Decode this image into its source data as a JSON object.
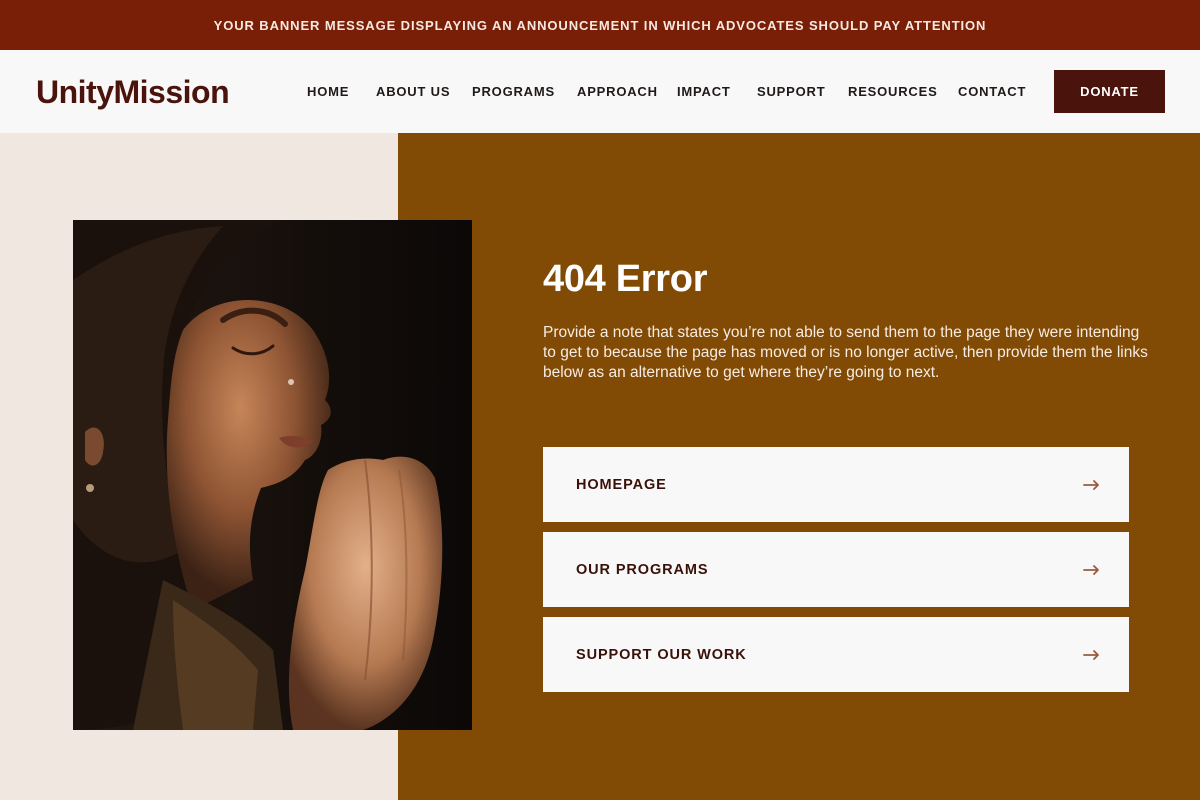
{
  "banner": {
    "text": "YOUR BANNER MESSAGE DISPLAYING AN ANNOUNCEMENT IN WHICH ADVOCATES SHOULD PAY ATTENTION"
  },
  "header": {
    "logo": "UnityMission",
    "nav": [
      "HOME",
      "ABOUT US",
      "PROGRAMS",
      "APPROACH",
      "IMPACT",
      "SUPPORT",
      "RESOURCES",
      "CONTACT"
    ],
    "donate_label": "DONATE"
  },
  "main": {
    "title": "404 Error",
    "description": "Provide a note that states you’re not able to send them to the page they were intending to get to because the page has moved or is no longer active, then provide them the links below as an alternative to get where they’re going to next.",
    "links": [
      {
        "label": "HOMEPAGE"
      },
      {
        "label": "OUR PROGRAMS"
      },
      {
        "label": "SUPPORT OUR WORK"
      }
    ]
  },
  "colors": {
    "banner": "#7a1f07",
    "brand_dark": "#4a130c",
    "right_panel": "#814b05",
    "left_panel": "#f0e7e1",
    "arrow": "#9b5a3a"
  },
  "icons": {
    "link_arrow": "arrow-right-icon"
  }
}
